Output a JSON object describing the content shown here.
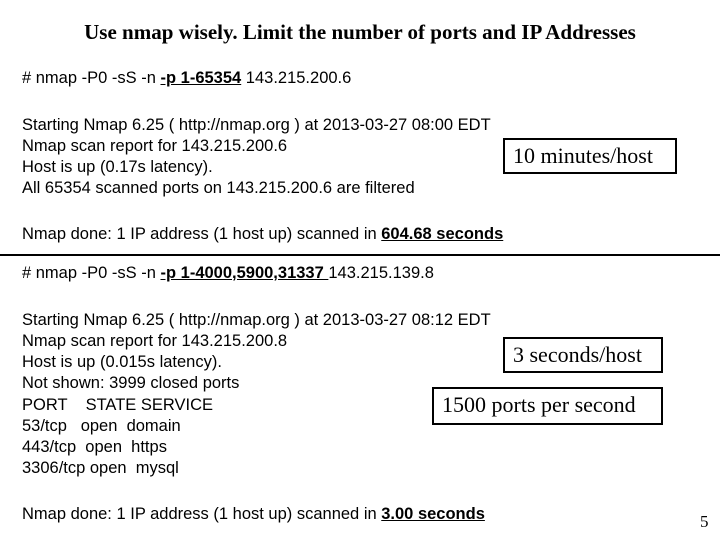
{
  "title": "Use nmap wisely. Limit the number of ports and IP Addresses",
  "scan1": {
    "command_prefix": "# nmap -P0 -sS -n ",
    "command_ports": "-p 1-65354",
    "command_suffix": " 143.215.200.6",
    "output": [
      "Starting Nmap 6.25 ( http://nmap.org ) at 2013-03-27 08:00 EDT",
      "Nmap scan report for 143.215.200.6",
      "Host is up (0.17s latency).",
      "All 65354 scanned ports on 143.215.200.6 are filtered"
    ],
    "done_prefix": "Nmap done: 1 IP address (1 host up) scanned in ",
    "done_time": "604.68 seconds",
    "callout": "10 minutes/host"
  },
  "scan2": {
    "command_prefix": "# nmap -P0 -sS -n ",
    "command_ports": "-p 1-4000,5900,31337 ",
    "command_suffix": "143.215.139.8",
    "output": [
      "Starting Nmap 6.25 ( http://nmap.org ) at 2013-03-27 08:12 EDT",
      "Nmap scan report for 143.215.200.8",
      "Host is up (0.015s latency).",
      "Not shown: 3999 closed ports",
      "PORT    STATE SERVICE",
      "53/tcp   open  domain",
      "443/tcp  open  https",
      "3306/tcp open  mysql"
    ],
    "done_prefix": "Nmap done: 1 IP address (1 host up) scanned in ",
    "done_time": "3.00 seconds",
    "callout_rate": "3 seconds/host",
    "callout_ports": "1500 ports per second"
  },
  "page_number": "5"
}
